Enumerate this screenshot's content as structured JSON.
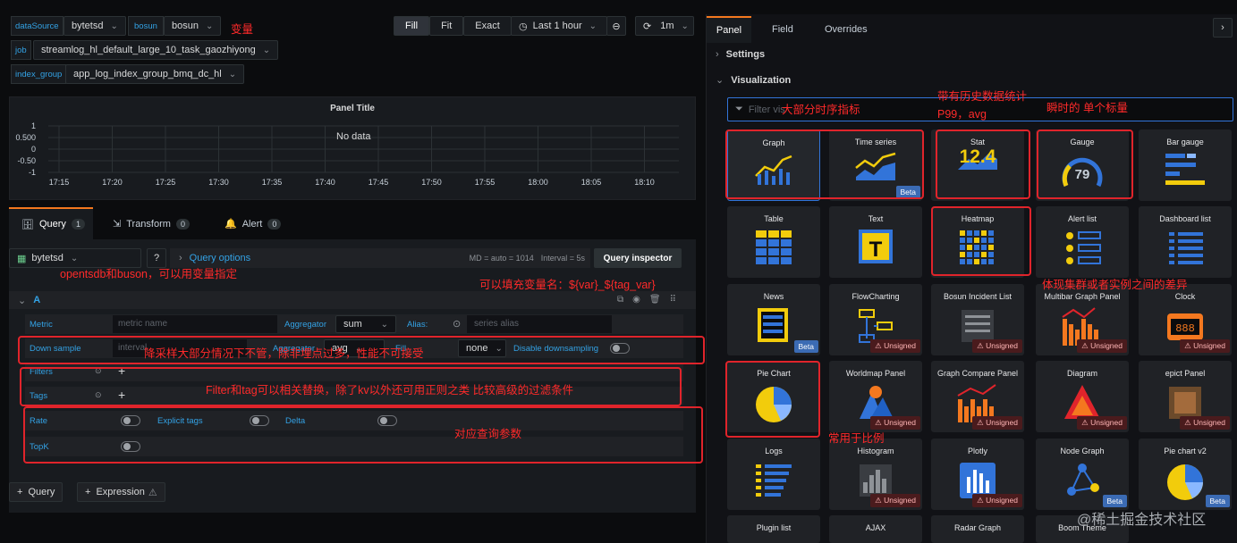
{
  "variables": {
    "datasource_label": "dataSource",
    "datasource_value": "bytetsd",
    "bosun_label": "bosun",
    "bosun_value": "bosun",
    "job_label": "job",
    "job_value": "streamlog_hl_default_large_10_task_gaozhiyong",
    "index_group_label": "index_group",
    "index_group_value": "app_log_index_group_bmq_dc_hl"
  },
  "toolbar": {
    "fill": "Fill",
    "fit": "Fit",
    "exact": "Exact",
    "time_range": "Last 1 hour",
    "refresh": "1m"
  },
  "panel": {
    "title": "Panel Title",
    "no_data": "No data"
  },
  "chart_data": {
    "type": "line",
    "title": "Panel Title",
    "y_ticks": [
      "1",
      "0.500",
      "0",
      "-0.50",
      "-1"
    ],
    "x_ticks": [
      "17:15",
      "17:20",
      "17:25",
      "17:30",
      "17:35",
      "17:40",
      "17:45",
      "17:50",
      "17:55",
      "18:00",
      "18:05",
      "18:10"
    ],
    "series": [],
    "annotation": "No data",
    "grid": true
  },
  "tabs": {
    "query": "Query",
    "query_count": "1",
    "transform": "Transform",
    "transform_count": "0",
    "alert": "Alert",
    "alert_count": "0"
  },
  "query_bar": {
    "datasource": "bytetsd",
    "options": "Query options",
    "md": "MD = auto = 1014",
    "interval": "Interval = 5s",
    "inspector": "Query inspector"
  },
  "query": {
    "letter": "A",
    "metric_label": "Metric",
    "metric_placeholder": "metric name",
    "aggregator_label": "Aggregator",
    "aggregator_value": "sum",
    "alias_label": "Alias:",
    "alias_placeholder": "series alias",
    "downsample_label": "Down sample",
    "interval_placeholder": "interval",
    "ds_agg_label": "Aggregator",
    "ds_agg_value": "avg",
    "fill_label": "Fill",
    "fill_value": "none",
    "disable_ds_label": "Disable downsampling",
    "filters_label": "Filters",
    "tags_label": "Tags",
    "rate_label": "Rate",
    "explicit_tags_label": "Explicit tags",
    "delta_label": "Delta",
    "topk_label": "TopK"
  },
  "bottom": {
    "add_query": "Query",
    "add_expression": "Expression"
  },
  "right_tabs": {
    "panel": "Panel",
    "field": "Field",
    "overrides": "Overrides"
  },
  "sections": {
    "settings": "Settings",
    "visualization": "Visualization"
  },
  "search": {
    "placeholder": "Filter vis"
  },
  "viz": {
    "graph": "Graph",
    "timeseries": "Time series",
    "stat": "Stat",
    "stat_value": "12.4",
    "gauge": "Gauge",
    "gauge_value": "79",
    "bar_gauge": "Bar gauge",
    "table": "Table",
    "text": "Text",
    "heatmap": "Heatmap",
    "alert_list": "Alert list",
    "dashboard_list": "Dashboard list",
    "news": "News",
    "flowcharting": "FlowCharting",
    "bosun_incident": "Bosun Incident List",
    "multibar": "Multibar Graph Panel",
    "clock": "Clock",
    "pie_chart": "Pie Chart",
    "worldmap": "Worldmap Panel",
    "graph_compare": "Graph Compare Panel",
    "diagram": "Diagram",
    "epict": "epict Panel",
    "logs": "Logs",
    "histogram": "Histogram",
    "plotly": "Plotly",
    "node_graph": "Node Graph",
    "pie_chart_v2": "Pie chart v2",
    "plugin_list": "Plugin list",
    "ajax": "AJAX",
    "radar_graph": "Radar Graph",
    "boom_theme": "Boom Theme",
    "beta": "Beta",
    "unsigned": "Unsigned"
  },
  "annotations": {
    "variables": "变量",
    "datasource_note": "opentsdb和buson，可以用变量指定",
    "alias_note": "可以填充变量名：${var}_${tag_var}",
    "downsample_note": "降采样大部分情况下不管，除非埋点过多，性能不可接受",
    "filter_note": "Filter和tag可以相关替换，除了kv以外还可用正则之类 比较高级的过滤条件",
    "params_note": "对应查询参数",
    "timeseries_note": "大部分时序指标",
    "stat_note": "带有历史数据统计 P99，avg",
    "gauge_note": "瞬时的 单个标量",
    "heatmap_note": "体现集群或者实例之间的差异",
    "pie_note": "常用于比例"
  },
  "watermark": "@稀土掘金技术社区"
}
